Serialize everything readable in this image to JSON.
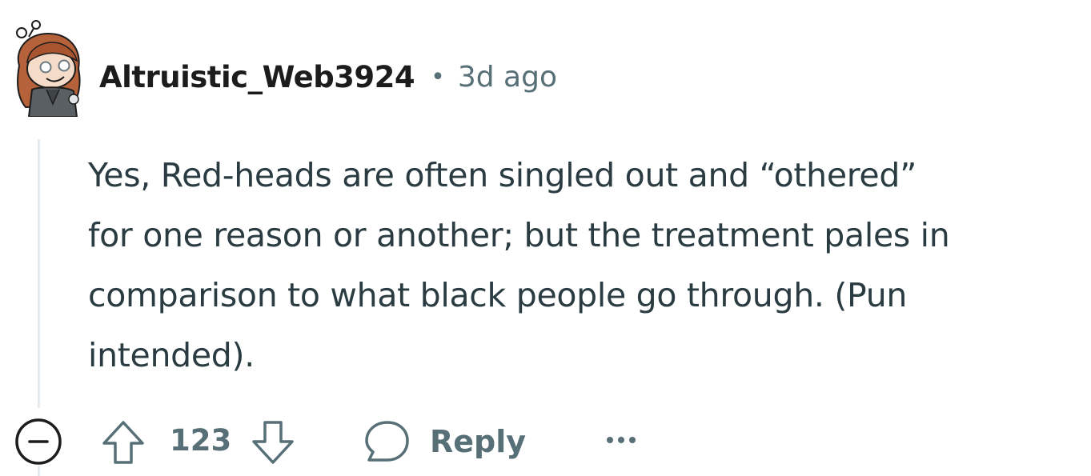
{
  "comment": {
    "author": "Altruistic_Web3924",
    "separator": "•",
    "timestamp": "3d ago",
    "body": "Yes, Red-heads are often singled out and “othered”\nfor one reason or another; but the treatment pales in\ncomparison to what black people go through. (Pun\nintended).",
    "avatar_icon": "snoo-avatar-icon"
  },
  "actions": {
    "collapse_icon": "minus-circle-icon",
    "upvote_icon": "arrow-up-icon",
    "vote_count": "123",
    "downvote_icon": "arrow-down-icon",
    "reply_icon": "speech-bubble-icon",
    "reply_label": "Reply",
    "more_icon": "ellipsis-icon"
  },
  "colors": {
    "text_primary": "#1c1c1c",
    "text_body": "#2a3c42",
    "text_meta": "#576f76",
    "thread_line": "#e5ebee"
  }
}
